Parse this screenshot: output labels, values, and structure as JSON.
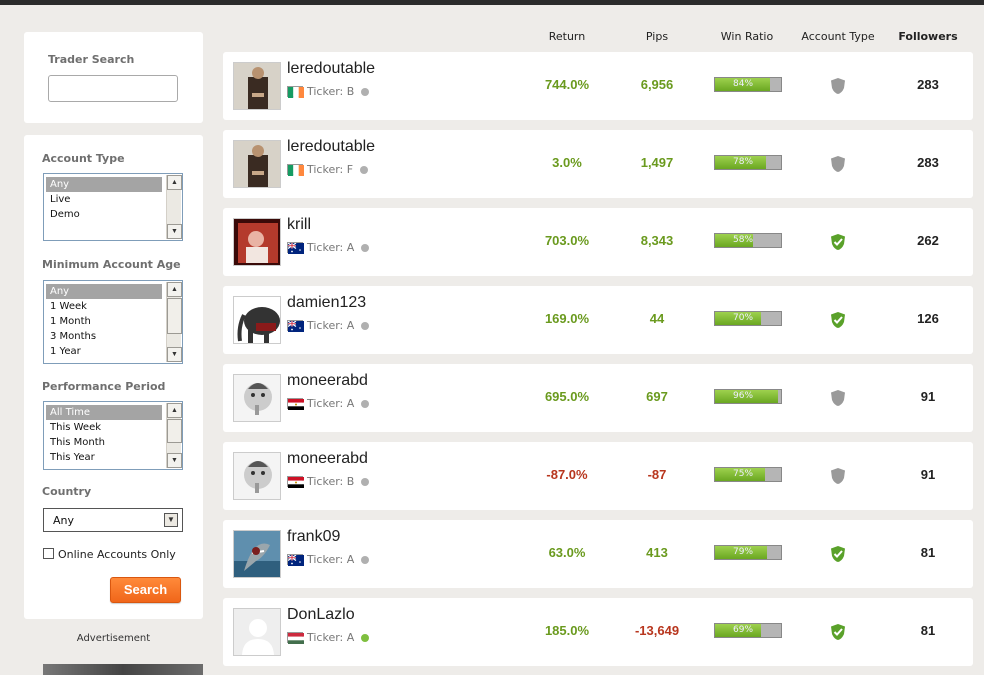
{
  "sidebar": {
    "trader_search_label": "Trader Search",
    "account_type_label": "Account Type",
    "account_type_options": [
      "Any",
      "Live",
      "Demo"
    ],
    "min_age_label": "Minimum Account Age",
    "min_age_options": [
      "Any",
      "1 Week",
      "1 Month",
      "3 Months",
      "1 Year"
    ],
    "performance_label": "Performance Period",
    "performance_options": [
      "All Time",
      "This Week",
      "This Month",
      "This Year"
    ],
    "country_label": "Country",
    "country_value": "Any",
    "online_only_label": "Online Accounts Only",
    "search_button": "Search",
    "ad_label": "Advertisement"
  },
  "columns": {
    "return": "Return",
    "pips": "Pips",
    "win_ratio": "Win Ratio",
    "account_type": "Account Type",
    "followers": "Followers"
  },
  "colors": {
    "positive": "#6a9a1e",
    "negative": "#b8361e",
    "verified_shield": "#5aa12a",
    "unverified_shield": "#9a9a9a",
    "online": "#7fbf3f",
    "offline": "#b0b0b0",
    "accent_button": "#f0661a"
  },
  "traders": [
    {
      "name": "leredoutable",
      "ticker": "Ticker: B",
      "flag": "ireland",
      "online": false,
      "ret": "744.0%",
      "pips": "6,956",
      "win": 84,
      "win_label": "84%",
      "verified": false,
      "followers": "283",
      "neg": false
    },
    {
      "name": "leredoutable",
      "ticker": "Ticker: F",
      "flag": "ireland",
      "online": false,
      "ret": "3.0%",
      "pips": "1,497",
      "win": 78,
      "win_label": "78%",
      "verified": false,
      "followers": "283",
      "neg": false
    },
    {
      "name": "krill",
      "ticker": "Ticker: A",
      "flag": "australia",
      "online": false,
      "ret": "703.0%",
      "pips": "8,343",
      "win": 58,
      "win_label": "58%",
      "verified": true,
      "followers": "262",
      "neg": false
    },
    {
      "name": "damien123",
      "ticker": "Ticker: A",
      "flag": "australia",
      "online": false,
      "ret": "169.0%",
      "pips": "44",
      "win": 70,
      "win_label": "70%",
      "verified": true,
      "followers": "126",
      "neg": false
    },
    {
      "name": "moneerabd",
      "ticker": "Ticker: A",
      "flag": "egypt",
      "online": false,
      "ret": "695.0%",
      "pips": "697",
      "win": 96,
      "win_label": "96%",
      "verified": false,
      "followers": "91",
      "neg": false
    },
    {
      "name": "moneerabd",
      "ticker": "Ticker: B",
      "flag": "egypt",
      "online": false,
      "ret": "-87.0%",
      "pips": "-87",
      "win": 75,
      "win_label": "75%",
      "verified": false,
      "followers": "91",
      "neg": true
    },
    {
      "name": "frank09",
      "ticker": "Ticker: A",
      "flag": "australia",
      "online": false,
      "ret": "63.0%",
      "pips": "413",
      "win": 79,
      "win_label": "79%",
      "verified": true,
      "followers": "81",
      "neg": false
    },
    {
      "name": "DonLazlo",
      "ticker": "Ticker: A",
      "flag": "hungary",
      "online": true,
      "ret": "185.0%",
      "pips": "-13,649",
      "win": 69,
      "win_label": "69%",
      "verified": true,
      "followers": "81",
      "neg": false,
      "pips_neg": true
    }
  ]
}
